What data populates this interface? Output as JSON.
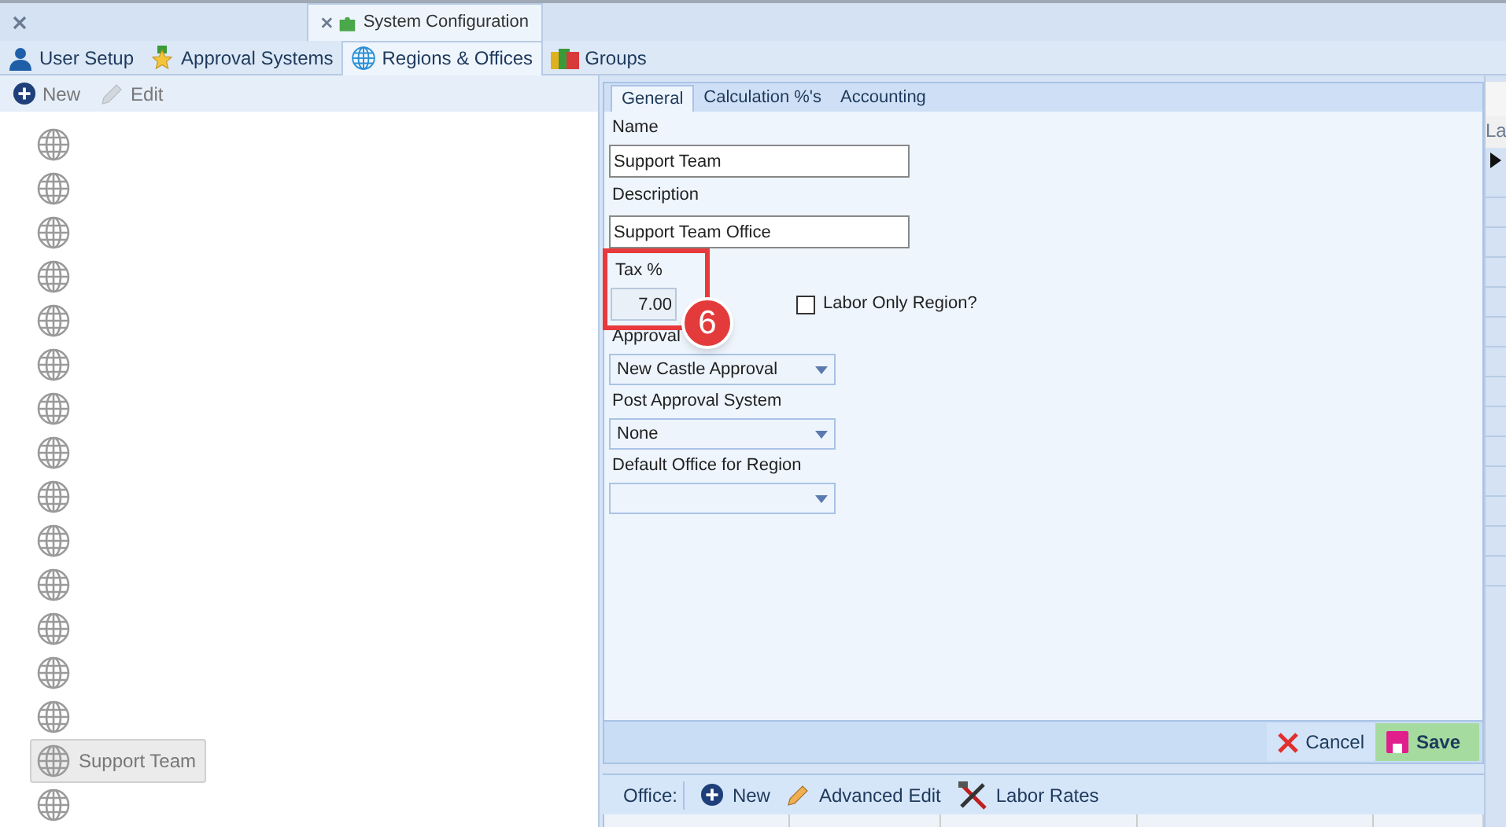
{
  "doc_tabs": [
    {
      "selected": false
    },
    {
      "label": "System Configuration",
      "selected": true
    }
  ],
  "module_tabs": [
    {
      "label": "User Setup",
      "selected": false
    },
    {
      "label": "Approval Systems",
      "selected": false
    },
    {
      "label": "Regions & Offices",
      "selected": true
    },
    {
      "label": "Groups",
      "selected": false
    }
  ],
  "tree_toolbar": [
    {
      "label": "New"
    },
    {
      "label": "Edit"
    }
  ],
  "tree": [
    {
      "selected": false
    },
    {
      "selected": false
    },
    {
      "selected": false
    },
    {
      "selected": false
    },
    {
      "selected": false
    },
    {
      "selected": false
    },
    {
      "selected": false
    },
    {
      "selected": false
    },
    {
      "selected": false
    },
    {
      "selected": false
    },
    {
      "selected": false
    },
    {
      "selected": false
    },
    {
      "selected": false
    },
    {
      "selected": false
    },
    {
      "label": "Support Team",
      "selected": true
    },
    {
      "selected": false
    }
  ],
  "form_tabs": [
    {
      "label": "General",
      "selected": true
    },
    {
      "label": "Calculation %'s",
      "selected": false
    },
    {
      "label": "Accounting",
      "selected": false
    }
  ],
  "form": {
    "name_label": "Name",
    "name": "Support Team",
    "description_label": "Description",
    "description": "Support Team Office",
    "tax_label": "Tax %",
    "tax": "7.00",
    "labor_only": {
      "label": "Labor Only Region?",
      "checked": false
    },
    "dropdowns": [
      {
        "label": "Approval",
        "value": "New Castle Approval"
      },
      {
        "label": "Post Approval System",
        "value": "None"
      },
      {
        "label": "Default Office for Region"
      }
    ]
  },
  "callout": {
    "label": "6"
  },
  "actions": [
    {
      "label": "Cancel",
      "kind": "cancel"
    },
    {
      "label": "Save",
      "kind": "save"
    }
  ],
  "office_toolbar": {
    "label": "Office:",
    "buttons": [
      {
        "label": "New"
      },
      {
        "label": "Advanced Edit"
      },
      {
        "label": "Labor Rates"
      }
    ]
  },
  "side_grid": {
    "header": "La"
  }
}
